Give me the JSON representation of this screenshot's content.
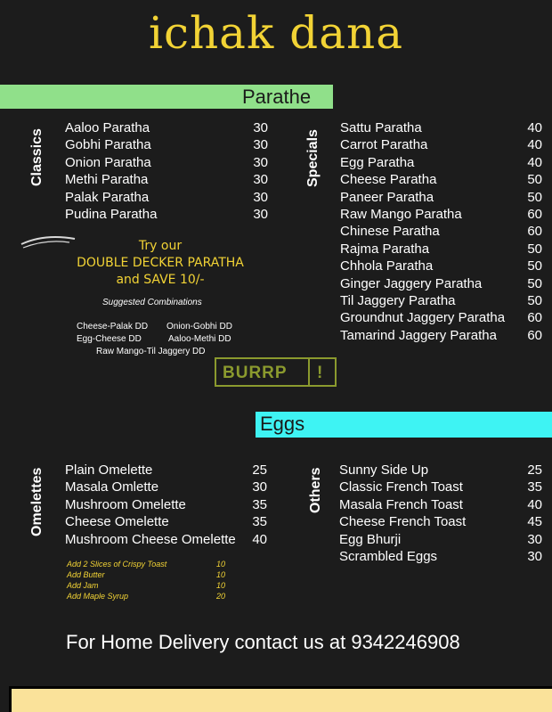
{
  "brand": "ichak dana",
  "parathe": {
    "title": "Parathe",
    "classics": {
      "label": "Classics",
      "items": [
        {
          "name": "Aaloo Paratha",
          "price": "30"
        },
        {
          "name": "Gobhi Paratha",
          "price": "30"
        },
        {
          "name": "Onion Paratha",
          "price": "30"
        },
        {
          "name": "Methi Paratha",
          "price": "30"
        },
        {
          "name": "Palak Paratha",
          "price": "30"
        },
        {
          "name": "Pudina Paratha",
          "price": "30"
        }
      ]
    },
    "specials": {
      "label": "Specials",
      "items": [
        {
          "name": "Sattu Paratha",
          "price": "40"
        },
        {
          "name": "Carrot Paratha",
          "price": "40"
        },
        {
          "name": "Egg Paratha",
          "price": "40"
        },
        {
          "name": "Cheese Paratha",
          "price": "50"
        },
        {
          "name": "Paneer Paratha",
          "price": "50"
        },
        {
          "name": "Raw Mango Paratha",
          "price": "60"
        },
        {
          "name": "Chinese Paratha",
          "price": "60"
        },
        {
          "name": "Rajma Paratha",
          "price": "50"
        },
        {
          "name": "Chhola Paratha",
          "price": "50"
        },
        {
          "name": "Ginger Jaggery Paratha",
          "price": "50"
        },
        {
          "name": "Til Jaggery Paratha",
          "price": "50"
        },
        {
          "name": "Groundnut Jaggery Paratha",
          "price": "60"
        },
        {
          "name": "Tamarind Jaggery Paratha",
          "price": "60"
        }
      ]
    },
    "promo": {
      "line1": "Try our",
      "line2": "DOUBLE DECKER PARATHA",
      "line3": "and SAVE 10/-",
      "suggested": "Suggested Combinations",
      "combos": [
        "Cheese-Palak DD",
        "Onion-Gobhi DD",
        "Egg-Cheese DD",
        "Aaloo-Methi DD",
        "Raw Mango-Til Jaggery DD"
      ]
    }
  },
  "burrp": {
    "text": "BURRP",
    "bang": "!"
  },
  "eggs": {
    "title": "Eggs",
    "omelettes": {
      "label": "Omelettes",
      "items": [
        {
          "name": "Plain Omelette",
          "price": "25"
        },
        {
          "name": "Masala Omlette",
          "price": "30"
        },
        {
          "name": "Mushroom Omelette",
          "price": "35"
        },
        {
          "name": "Cheese Omelette",
          "price": "35"
        },
        {
          "name": "Mushroom Cheese Omelette",
          "price": "40"
        }
      ]
    },
    "addons": [
      {
        "name": "Add  2 Slices of Crispy Toast",
        "price": "10"
      },
      {
        "name": "Add Butter",
        "price": "10"
      },
      {
        "name": "Add Jam",
        "price": "10"
      },
      {
        "name": "Add Maple Syrup",
        "price": "20"
      }
    ],
    "others": {
      "label": "Others",
      "items": [
        {
          "name": "Sunny Side Up",
          "price": "25"
        },
        {
          "name": "Classic French Toast",
          "price": "35"
        },
        {
          "name": "Masala French Toast",
          "price": "40"
        },
        {
          "name": "Cheese French Toast",
          "price": "45"
        },
        {
          "name": "Egg Bhurji",
          "price": "30"
        },
        {
          "name": "Scrambled Eggs",
          "price": "30"
        }
      ]
    }
  },
  "delivery": "For Home Delivery contact us at 9342246908",
  "colors": {
    "background": "#1c1c1c",
    "brand": "#f2d335",
    "parathe_band": "#90e08a",
    "eggs_band": "#3ef3f3",
    "footer_band": "#fae29a",
    "burrp": "#8b9a2e"
  }
}
